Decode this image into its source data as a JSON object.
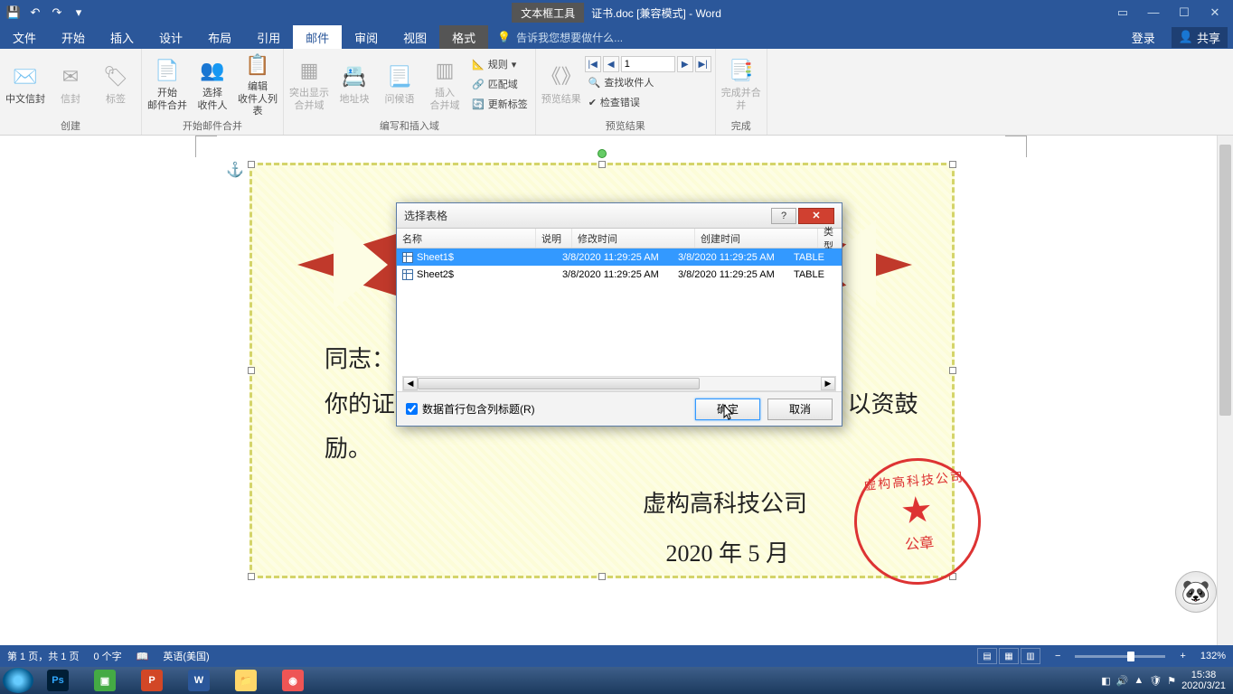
{
  "titlebar": {
    "context_tool": "文本框工具",
    "doc_title": "证书.doc [兼容模式] - Word"
  },
  "menu": {
    "file": "文件",
    "home": "开始",
    "insert": "插入",
    "design": "设计",
    "layout": "布局",
    "references": "引用",
    "mailings": "邮件",
    "review": "审阅",
    "view": "视图",
    "format": "格式",
    "tellme": "告诉我您想要做什么...",
    "login": "登录",
    "share": "共享"
  },
  "ribbon": {
    "groups": {
      "create": "创建",
      "start": "开始邮件合并",
      "write": "编写和插入域",
      "preview": "预览结果",
      "finish": "完成"
    },
    "buttons": {
      "cn_envelope": "中文信封",
      "envelope": "信封",
      "labels": "标签",
      "start_merge": "开始\n邮件合并",
      "select_recipients": "选择\n收件人",
      "edit_recipients": "编辑\n收件人列表",
      "highlight_fields": "突出显示\n合并域",
      "address_block": "地址块",
      "greeting": "问候语",
      "insert_field": "插入\n合并域",
      "rules": "规则",
      "match_fields": "匹配域",
      "update_labels": "更新标签",
      "preview_results": "预览结果",
      "find_recipient": "查找收件人",
      "check_errors": "检查错误",
      "finish_merge": "完成并合并",
      "record_value": "1"
    }
  },
  "dialog": {
    "title": "选择表格",
    "columns": {
      "name": "名称",
      "desc": "说明",
      "modified": "修改时间",
      "created": "创建时间",
      "type": "类型"
    },
    "rows": [
      {
        "name": "Sheet1$",
        "modified": "3/8/2020 11:29:25 AM",
        "created": "3/8/2020 11:29:25 AM",
        "type": "TABLE"
      },
      {
        "name": "Sheet2$",
        "modified": "3/8/2020 11:29:25 AM",
        "created": "3/8/2020 11:29:25 AM",
        "type": "TABLE"
      }
    ],
    "checkbox": "数据首行包含列标题(R)",
    "ok": "确定",
    "cancel": "取消"
  },
  "document": {
    "line1": "同志：",
    "line2": "你的证件                                        ，虚构高科技公司优秀员工，特发此证，以资鼓励。",
    "company": "虚构高科技公司",
    "date": "2020 年 5 月",
    "seal_arc": "虚构高科技公司",
    "seal_label": "公章"
  },
  "status": {
    "page": "第 1 页，共 1 页",
    "words": "0 个字",
    "lang": "英语(美国)",
    "zoom": "132%"
  },
  "taskbar": {
    "time": "15:38",
    "date": "2020/3/21"
  }
}
